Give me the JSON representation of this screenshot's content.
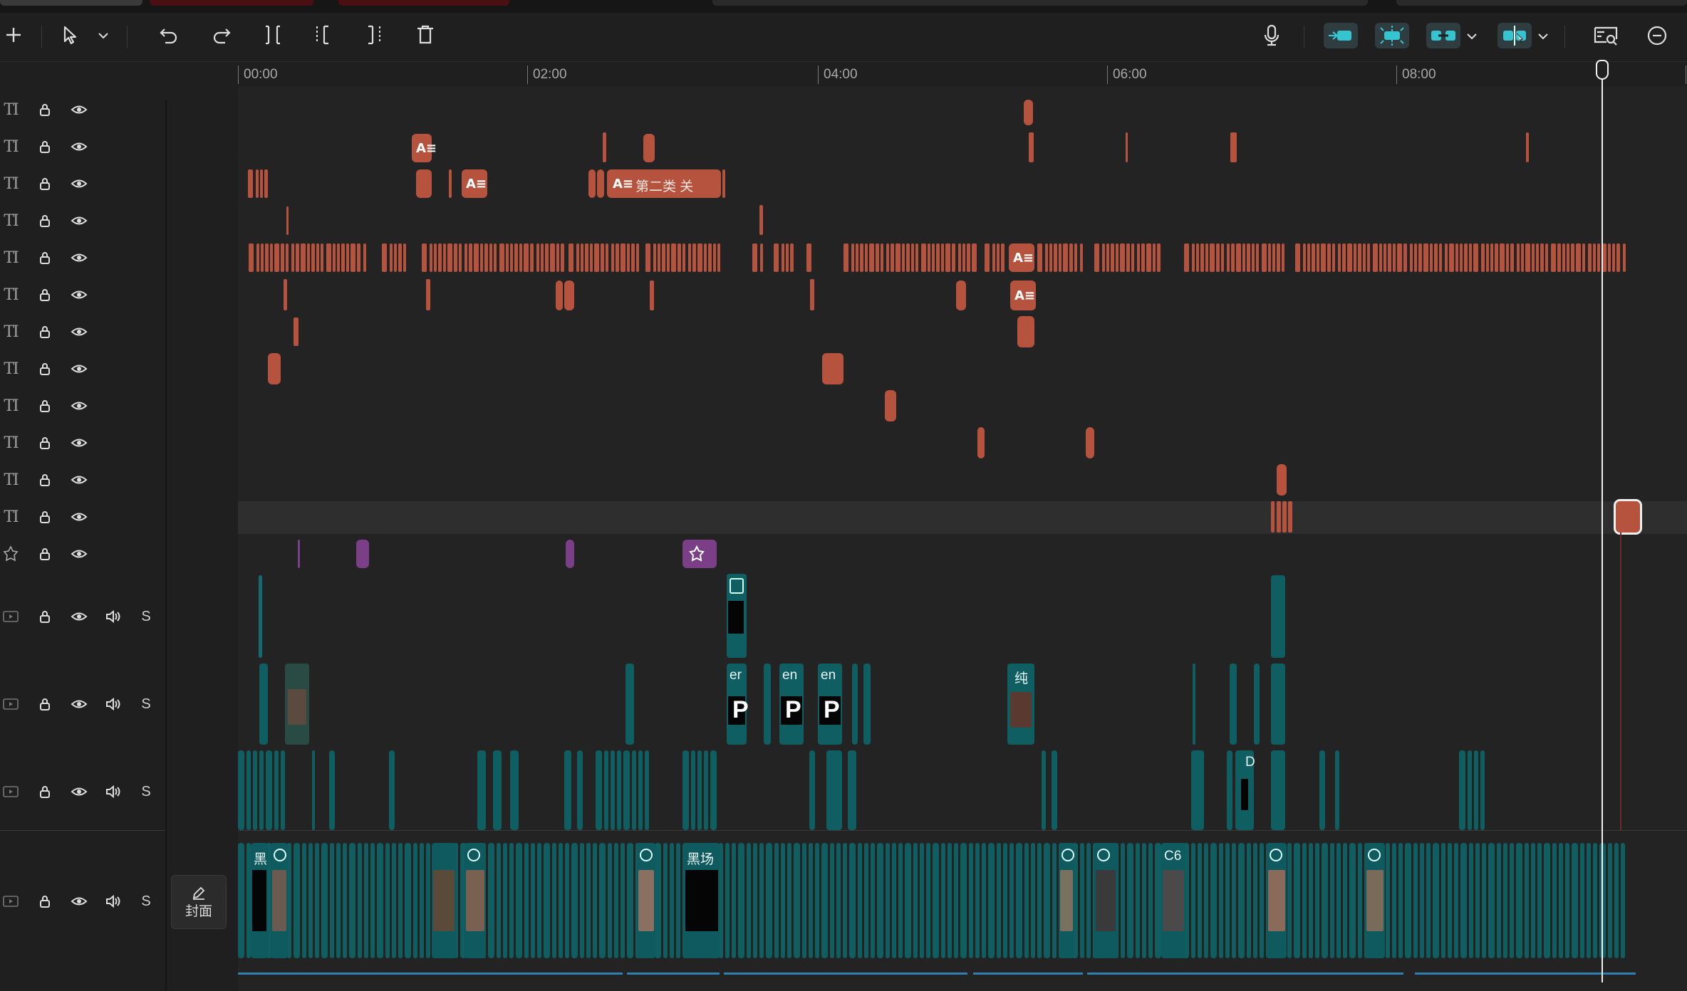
{
  "toolbar": {
    "tools": [
      {
        "name": "add-icon",
        "label": "+"
      },
      {
        "name": "select-pointer-icon"
      },
      {
        "name": "select-dropdown-icon"
      },
      {
        "name": "undo-icon"
      },
      {
        "name": "redo-icon"
      },
      {
        "name": "split-icon"
      },
      {
        "name": "split-left-icon"
      },
      {
        "name": "split-right-icon"
      },
      {
        "name": "delete-icon"
      }
    ],
    "right_tools": [
      {
        "name": "microphone-icon"
      },
      {
        "name": "main-track-magnet-icon"
      },
      {
        "name": "auto-snap-icon"
      },
      {
        "name": "linkage-icon"
      },
      {
        "name": "preview-axis-icon"
      },
      {
        "name": "fit-timeline-icon"
      },
      {
        "name": "zoom-out-icon"
      }
    ],
    "accent_color": "#36c5d0"
  },
  "ruler": {
    "labels": [
      "00:00",
      "02:00",
      "04:00",
      "06:00",
      "08:00"
    ]
  },
  "track_headers": {
    "text_track_glyph": "TI",
    "solo_label": "S",
    "cover_label": "封面"
  },
  "clips": {
    "text_clip_label": "第二类 关",
    "ae_badge": "A≡",
    "video_labels": {
      "en_1": "er",
      "en_2": "en",
      "en_3": "en",
      "p_1": "P",
      "p_2": "P",
      "p_3": "P",
      "chun": "纯",
      "d": "D",
      "main_hei": "黑",
      "main_heichang": "黑场",
      "main_c6": "C6"
    }
  },
  "colors": {
    "text_clip": "#b5533e",
    "effect_clip": "#7a3f86",
    "video_clip": "#0f5e62",
    "playhead": "#f0f0f0"
  }
}
